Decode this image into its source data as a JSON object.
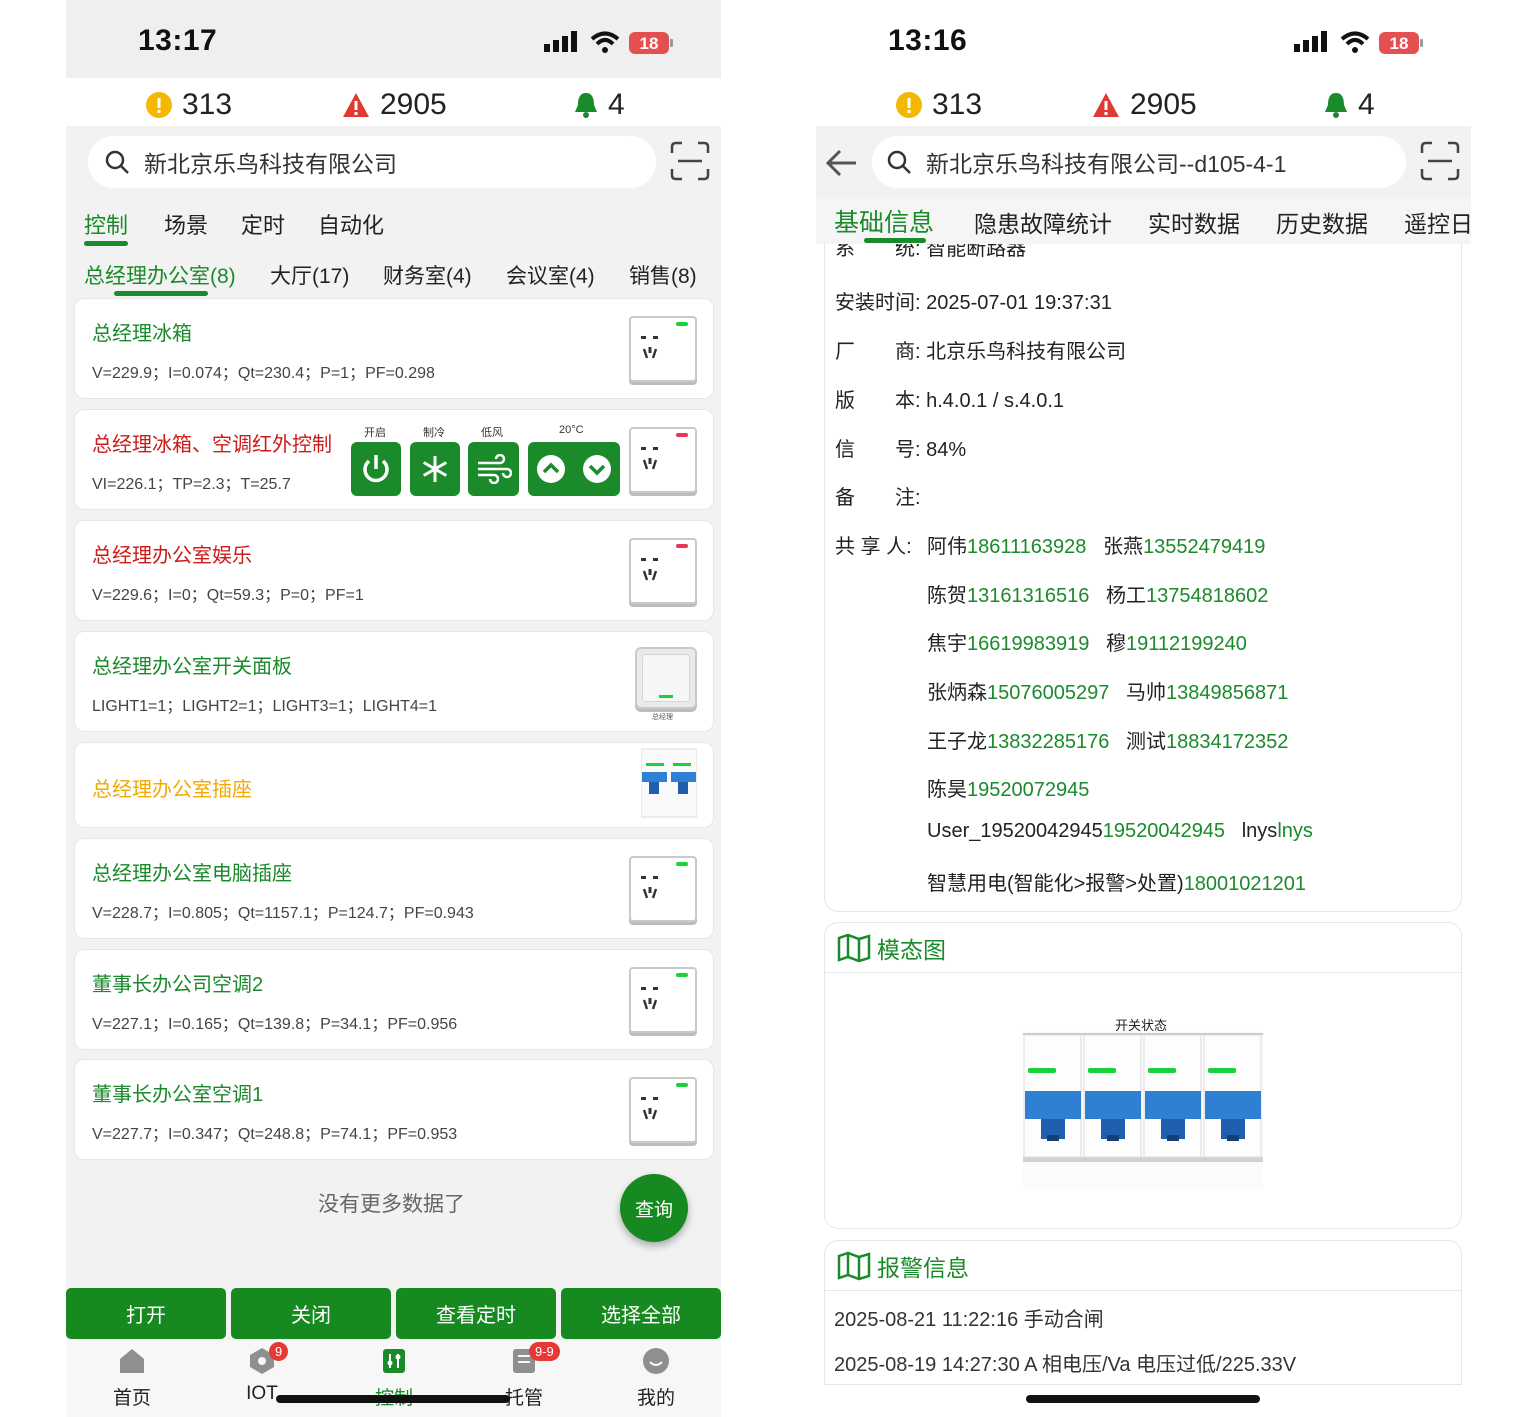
{
  "left": {
    "status": {
      "time": "13:17",
      "battery": "18"
    },
    "counts": {
      "info": "313",
      "warning": "2905",
      "bell": "4"
    },
    "search": {
      "text": "新北京乐鸟科技有限公司"
    },
    "tabs": [
      "控制",
      "场景",
      "定时",
      "自动化"
    ],
    "rooms": [
      "总经理办公室(8)",
      "大厅(17)",
      "财务室(4)",
      "会议室(4)",
      "销售(8)"
    ],
    "devices": [
      {
        "name": "总经理冰箱",
        "readout": "V=229.9；I=0.074；Qt=230.4；P=1；PF=0.298",
        "color": "#1a8a2a",
        "led": "#18d23a"
      },
      {
        "name": "总经理冰箱、空调红外控制",
        "readout": "VI=226.1；TP=2.3；T=25.7",
        "color": "#cc1b1b",
        "led": "#e53955"
      },
      {
        "name": "总经理办公室娱乐",
        "readout": "V=229.6；I=0；Qt=59.3；P=0；PF=1",
        "color": "#cc1b1b",
        "led": "#e53955"
      },
      {
        "name": "总经理办公室开关面板",
        "readout": "LIGHT1=1；LIGHT2=1；LIGHT3=1；LIGHT4=1",
        "color": "#1a8a2a",
        "panel_label": "总经理"
      },
      {
        "name": "总经理办公室插座",
        "readout": "",
        "color": "#f2a900"
      },
      {
        "name": "总经理办公室电脑插座",
        "readout": "V=228.7；I=0.805；Qt=1157.1；P=124.7；PF=0.943",
        "color": "#1a8a2a",
        "led": "#18d23a"
      },
      {
        "name": "董事长办公司空调2",
        "readout": "V=227.1；I=0.165；Qt=139.8；P=34.1；PF=0.956",
        "color": "#1a8a2a",
        "led": "#18d23a"
      },
      {
        "name": "董事长办公室空调1",
        "readout": "V=227.7；I=0.347；Qt=248.8；P=74.1；PF=0.953",
        "color": "#1a8a2a",
        "led": "#18d23a"
      }
    ],
    "ir_controls": {
      "power": "开启",
      "mode": "制冷",
      "fan": "低风",
      "temp": "20°C"
    },
    "no_more": "没有更多数据了",
    "fab": "查询",
    "actions": [
      "打开",
      "关闭",
      "查看定时",
      "选择全部"
    ],
    "nav": [
      {
        "label": "首页",
        "icon": "home-icon"
      },
      {
        "label": "IOT",
        "icon": "iot-icon",
        "badge": "9"
      },
      {
        "label": "控制",
        "icon": "control-icon"
      },
      {
        "label": "托管",
        "icon": "managed-icon",
        "badge": "9-9"
      },
      {
        "label": "我的",
        "icon": "profile-icon"
      }
    ],
    "accent": "#1a8a2a"
  },
  "right": {
    "status": {
      "time": "13:16",
      "battery": "18"
    },
    "counts": {
      "info": "313",
      "warning": "2905",
      "bell": "4"
    },
    "search": {
      "text": "新北京乐鸟科技有限公司--d105-4-1"
    },
    "tabs": [
      "基础信息",
      "隐患故障统计",
      "实时数据",
      "历史数据",
      "遥控日"
    ],
    "info_cut": "系　　统: 智能断路器",
    "info": [
      {
        "label": "安装时间",
        "value": "2025-07-01 19:37:31"
      },
      {
        "label": "厂　　商",
        "value": "北京乐鸟科技有限公司"
      },
      {
        "label": "版　　本",
        "value": "h.4.0.1 / s.4.0.1"
      },
      {
        "label": "信　　号",
        "value": "84%"
      },
      {
        "label": "备　　注",
        "value": ""
      }
    ],
    "share_label": "共 享 人:",
    "sharers": [
      [
        {
          "name": "阿伟",
          "phone": "18611163928"
        },
        {
          "name": "张燕",
          "phone": "13552479419"
        }
      ],
      [
        {
          "name": "陈贺",
          "phone": "13161316516"
        },
        {
          "name": "杨工",
          "phone": "13754818602"
        }
      ],
      [
        {
          "name": "焦宇",
          "phone": "16619983919"
        },
        {
          "name": "穆",
          "phone": "19112199240"
        }
      ],
      [
        {
          "name": "张炳森",
          "phone": "15076005297"
        },
        {
          "name": "马帅",
          "phone": "13849856871"
        }
      ],
      [
        {
          "name": "王子龙",
          "phone": "13832285176"
        },
        {
          "name": "测试",
          "phone": "18834172352"
        }
      ],
      [
        {
          "name": "陈昊",
          "phone": "19520072945"
        }
      ],
      [
        {
          "name": "User_19520042945",
          "phone": "19520042945"
        },
        {
          "name": "lnys",
          "phone": "lnys"
        }
      ],
      [
        {
          "name": "智慧用电(智能化>报警>处置)",
          "phone": "18001021201"
        }
      ]
    ],
    "state_diagram": {
      "title": "模态图",
      "label": "开关状态"
    },
    "alarms": {
      "title": "报警信息",
      "items": [
        "2025-08-21 11:22:16 手动合闸",
        "2025-08-19 14:27:30 A 相电压/Va 电压过低/225.33V"
      ]
    }
  }
}
